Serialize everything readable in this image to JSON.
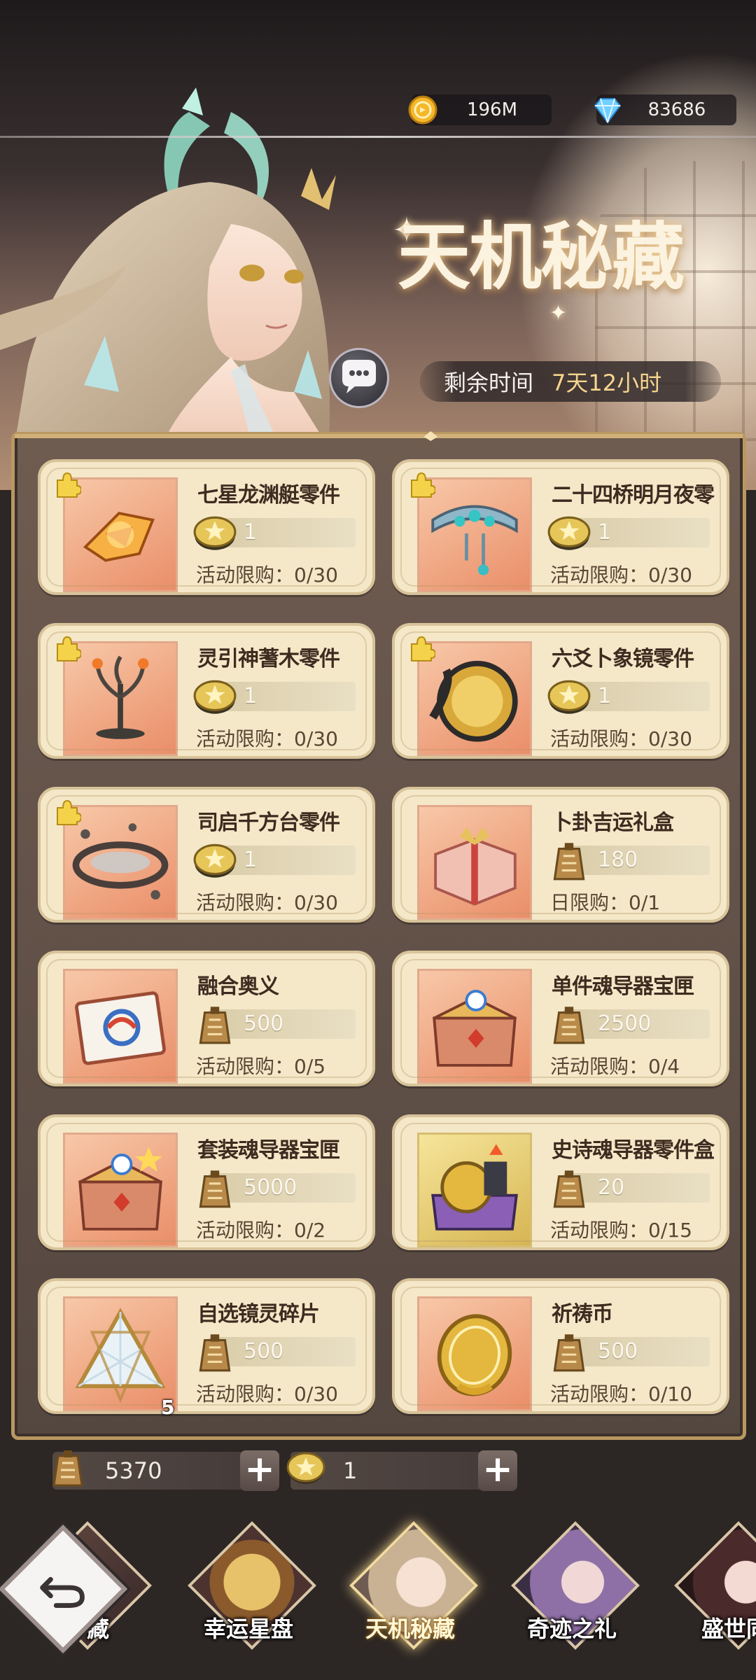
{
  "currency": {
    "gold": {
      "icon": "gold-coin-icon",
      "value": "196M"
    },
    "diamond": {
      "icon": "diamond-icon",
      "value": "83686"
    }
  },
  "banner": {
    "title": "天机秘藏",
    "time_label": "剩余时间",
    "time_value": "7天12小时"
  },
  "shop": {
    "items": [
      {
        "name": "七星龙渊艇零件",
        "price": "1",
        "limit": "活动限购：0/30",
        "cost_icon": "star-coin-icon",
        "has_puzzle": true
      },
      {
        "name": "二十四桥明月夜零",
        "price": "1",
        "limit": "活动限购：0/30",
        "cost_icon": "star-coin-icon",
        "has_puzzle": true
      },
      {
        "name": "灵引神蓍木零件",
        "price": "1",
        "limit": "活动限购：0/30",
        "cost_icon": "star-coin-icon",
        "has_puzzle": true
      },
      {
        "name": "六爻卜象镜零件",
        "price": "1",
        "limit": "活动限购：0/30",
        "cost_icon": "star-coin-icon",
        "has_puzzle": true
      },
      {
        "name": "司启千方台零件",
        "price": "1",
        "limit": "活动限购：0/30",
        "cost_icon": "star-coin-icon",
        "has_puzzle": true
      },
      {
        "name": "卜卦吉运礼盒",
        "price": "180",
        "limit": "日限购：0/1",
        "cost_icon": "talisman-token-icon",
        "has_puzzle": false
      },
      {
        "name": "融合奥义",
        "price": "500",
        "limit": "活动限购：0/5",
        "cost_icon": "talisman-token-icon",
        "has_puzzle": false
      },
      {
        "name": "单件魂导器宝匣",
        "price": "2500",
        "limit": "活动限购：0/4",
        "cost_icon": "talisman-token-icon",
        "has_puzzle": false
      },
      {
        "name": "套装魂导器宝匣",
        "price": "5000",
        "limit": "活动限购：0/2",
        "cost_icon": "talisman-token-icon",
        "has_puzzle": false
      },
      {
        "name": "史诗魂导器零件盒",
        "price": "20",
        "limit": "活动限购：0/15",
        "cost_icon": "talisman-token-icon",
        "has_puzzle": false
      },
      {
        "name": "自选镜灵碎片",
        "price": "500",
        "limit": "活动限购：0/30",
        "cost_icon": "talisman-token-icon",
        "has_puzzle": false,
        "badge": "5"
      },
      {
        "name": "祈祷币",
        "price": "500",
        "limit": "活动限购：0/10",
        "cost_icon": "talisman-token-icon",
        "has_puzzle": false
      }
    ]
  },
  "resources": {
    "talisman": {
      "icon": "talisman-token-icon",
      "value": "5370",
      "add": "+"
    },
    "star_coin": {
      "icon": "star-coin-icon",
      "value": "1",
      "add": "+"
    }
  },
  "tabs": [
    {
      "label": "藏"
    },
    {
      "label": "幸运星盘"
    },
    {
      "label": "天机秘藏",
      "active": true
    },
    {
      "label": "奇迹之礼"
    },
    {
      "label": "盛世同"
    }
  ]
}
